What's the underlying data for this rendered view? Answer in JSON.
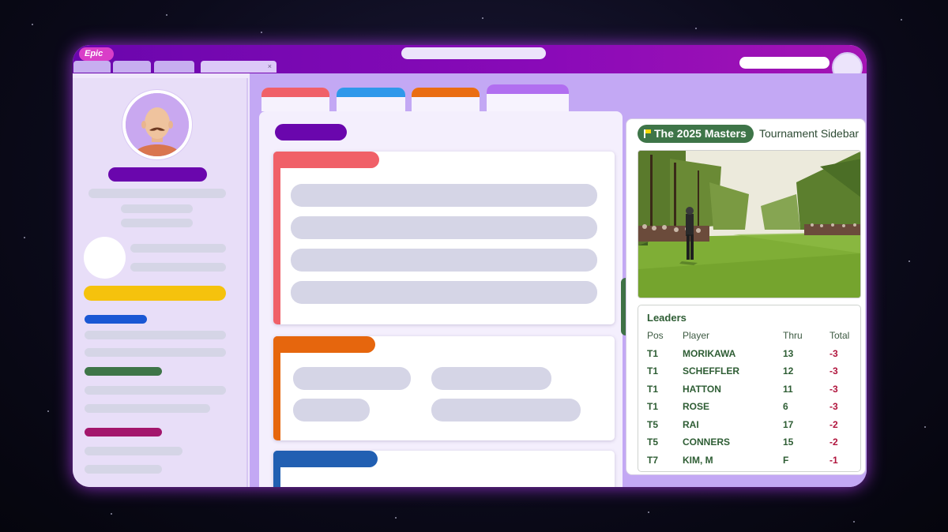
{
  "app": {
    "logo_text": "Epic"
  },
  "window": {
    "tabs": [
      {
        "label": ""
      },
      {
        "label": ""
      },
      {
        "label": ""
      },
      {
        "label": "",
        "close_symbol": "×"
      }
    ]
  },
  "colors": {
    "brand_purple": "#6a06ad",
    "masters_green": "#3e7548",
    "flag_yellow": "#f5d90a",
    "score_red": "#b0143c",
    "tab_red": "#f06068",
    "tab_blue": "#2f98ea",
    "tab_orange": "#ea6d12",
    "tab_violet": "#b16ef0"
  },
  "sidebar": {
    "avatar_icon": "user-avatar-icon",
    "accent_bars": [
      "#f5c20d",
      "#1a57d4",
      "#3e7548",
      "#a3166c"
    ]
  },
  "content_tabs": [
    {
      "color": "#f06068"
    },
    {
      "color": "#2f98ea"
    },
    {
      "color": "#ea6d12"
    },
    {
      "color": "#b16ef0"
    }
  ],
  "cards": [
    {
      "color": "#f06068"
    },
    {
      "color": "#e6660d"
    },
    {
      "color": "#215fb2"
    }
  ],
  "tournament": {
    "badge_label": "The 2025 Masters",
    "sidebar_label": "Tournament Sidebar",
    "flag_icon": "flag-icon",
    "leaders": {
      "title": "Leaders",
      "columns": {
        "pos": "Pos",
        "player": "Player",
        "thru": "Thru",
        "total": "Total"
      },
      "rows": [
        {
          "pos": "T1",
          "player": "MORIKAWA",
          "thru": "13",
          "total": "-3"
        },
        {
          "pos": "T1",
          "player": "SCHEFFLER",
          "thru": "12",
          "total": "-3"
        },
        {
          "pos": "T1",
          "player": "HATTON",
          "thru": "11",
          "total": "-3"
        },
        {
          "pos": "T1",
          "player": "ROSE",
          "thru": "6",
          "total": "-3"
        },
        {
          "pos": "T5",
          "player": "RAI",
          "thru": "17",
          "total": "-2"
        },
        {
          "pos": "T5",
          "player": "CONNERS",
          "thru": "15",
          "total": "-2"
        },
        {
          "pos": "T7",
          "player": "KIM, M",
          "thru": "F",
          "total": "-1"
        }
      ]
    }
  }
}
